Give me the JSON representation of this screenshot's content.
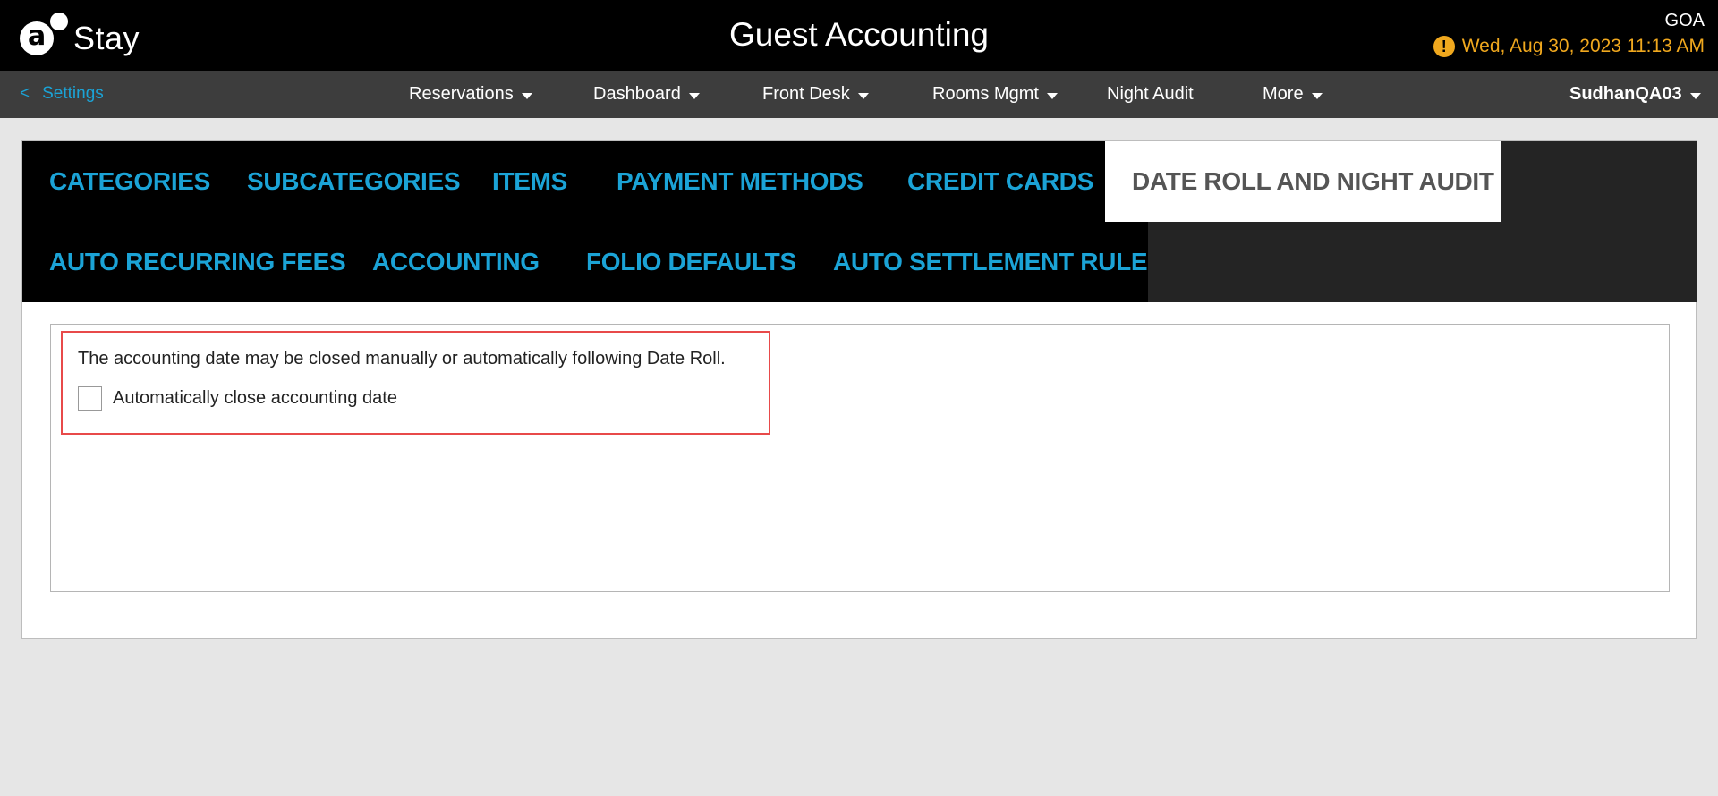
{
  "header": {
    "logo_text": "Stay",
    "title": "Guest Accounting",
    "property_code": "GOA",
    "warning_icon": "exclamation",
    "datetime": "Wed, Aug 30, 2023 11:13 AM"
  },
  "nav": {
    "back_chevron": "<",
    "back_label": "Settings",
    "items": [
      {
        "label": "Reservations"
      },
      {
        "label": "Dashboard"
      },
      {
        "label": "Front Desk"
      },
      {
        "label": "Rooms Mgmt"
      },
      {
        "label": "Night Audit"
      },
      {
        "label": "More"
      }
    ],
    "user": "SudhanQA03"
  },
  "tabs": {
    "row1": [
      {
        "label": "CATEGORIES"
      },
      {
        "label": "SUBCATEGORIES"
      },
      {
        "label": "ITEMS"
      },
      {
        "label": "PAYMENT METHODS"
      },
      {
        "label": "CREDIT CARDS"
      },
      {
        "label": "DATE ROLL AND NIGHT AUDIT"
      }
    ],
    "row2": [
      {
        "label": "AUTO RECURRING FEES"
      },
      {
        "label": "ACCOUNTING"
      },
      {
        "label": "FOLIO DEFAULTS"
      },
      {
        "label": "AUTO SETTLEMENT RULE"
      }
    ],
    "active": "DATE ROLL AND NIGHT AUDIT"
  },
  "content": {
    "description": "The accounting date may be closed manually or automatically following Date Roll.",
    "checkbox_label": "Automatically close accounting date",
    "checkbox_checked": false
  },
  "colors": {
    "accent": "#1ba3d6",
    "warning": "#f0a81e",
    "highlight_border": "#e84a4a"
  }
}
